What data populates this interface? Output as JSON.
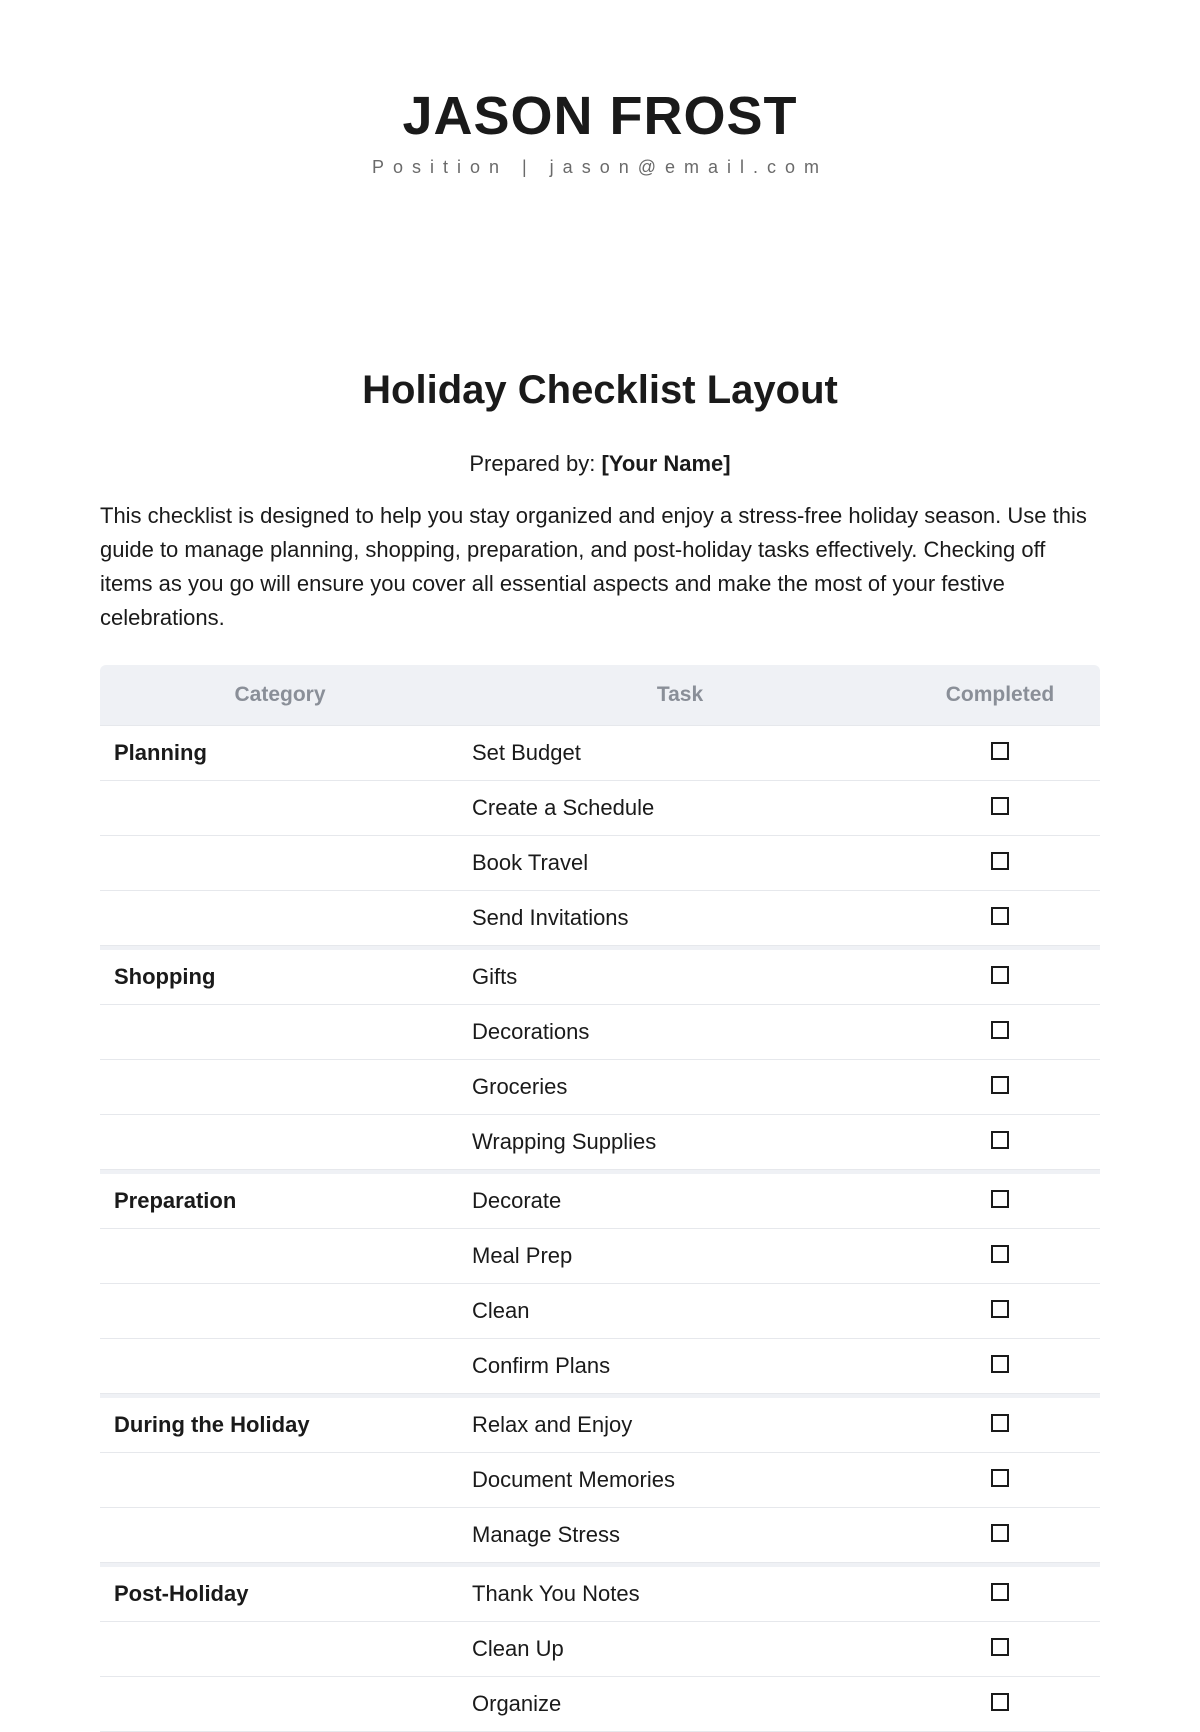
{
  "header": {
    "name": "JASON FROST",
    "subtitle": "Position | jason@email.com"
  },
  "title": "Holiday Checklist Layout",
  "prepared_by_label": "Prepared by: ",
  "prepared_by_value": "[Your Name]",
  "intro": "This checklist is designed to help you stay organized and enjoy a stress-free holiday season. Use this guide to manage planning, shopping, preparation, and post-holiday tasks effectively. Checking off items as you go will ensure you cover all essential aspects and make the most of your festive celebrations.",
  "table": {
    "headers": {
      "category": "Category",
      "task": "Task",
      "completed": "Completed"
    },
    "groups": [
      {
        "category": "Planning",
        "tasks": [
          "Set Budget",
          "Create a Schedule",
          "Book Travel",
          "Send Invitations"
        ]
      },
      {
        "category": "Shopping",
        "tasks": [
          "Gifts",
          "Decorations",
          "Groceries",
          "Wrapping Supplies"
        ]
      },
      {
        "category": "Preparation",
        "tasks": [
          "Decorate",
          "Meal Prep",
          "Clean",
          "Confirm Plans"
        ]
      },
      {
        "category": "During the Holiday",
        "tasks": [
          "Relax and Enjoy",
          "Document Memories",
          "Manage Stress"
        ]
      },
      {
        "category": "Post-Holiday",
        "tasks": [
          "Thank You Notes",
          "Clean Up",
          "Organize"
        ]
      }
    ]
  }
}
